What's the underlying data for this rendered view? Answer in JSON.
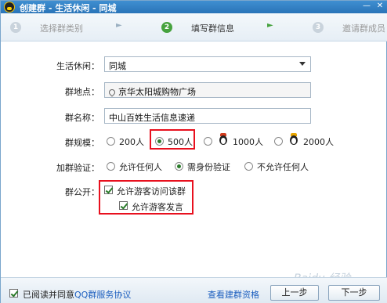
{
  "window": {
    "title": "创建群 - 生活休闲 - 同城",
    "minimize_glyph": "—",
    "close_glyph": "✕"
  },
  "steps": [
    {
      "num": "1",
      "label": "选择群类别",
      "state": "done"
    },
    {
      "num": "2",
      "label": "填写群信息",
      "state": "active"
    },
    {
      "num": "3",
      "label": "邀请群成员",
      "state": "todo"
    }
  ],
  "step_arrow_glyph": "►",
  "form": {
    "category": {
      "label": "生活休闲：",
      "value": "同城"
    },
    "location": {
      "label": "群地点：",
      "value": "京华太阳城购物广场"
    },
    "name": {
      "label": "群名称：",
      "value": "中山百姓生活信息速递"
    },
    "size": {
      "label": "群规模：",
      "options": [
        "200人",
        "500人",
        "1000人",
        "2000人"
      ],
      "selected": "500人"
    },
    "verify": {
      "label": "加群验证：",
      "options": [
        "允许任何人",
        "需身份验证",
        "不允许任何人"
      ],
      "selected": "需身份验证"
    },
    "public": {
      "label": "群公开：",
      "allow_visit": {
        "label": "允许游客访问该群",
        "checked": true
      },
      "allow_post": {
        "label": "允许游客发言",
        "checked": true
      }
    }
  },
  "bottom": {
    "agree_prefix": "已阅读并同意",
    "agree_link": "QQ群服务协议",
    "agree_checked": true,
    "check_qualification": "查看建群资格",
    "prev_label": "上一步",
    "next_label": "下一步"
  },
  "watermark": "Baidu 经验",
  "colors": {
    "title_bar": "#2a74b8",
    "active_step": "#46a23e",
    "highlight": "#e8101e",
    "link": "#1d5fbf"
  }
}
